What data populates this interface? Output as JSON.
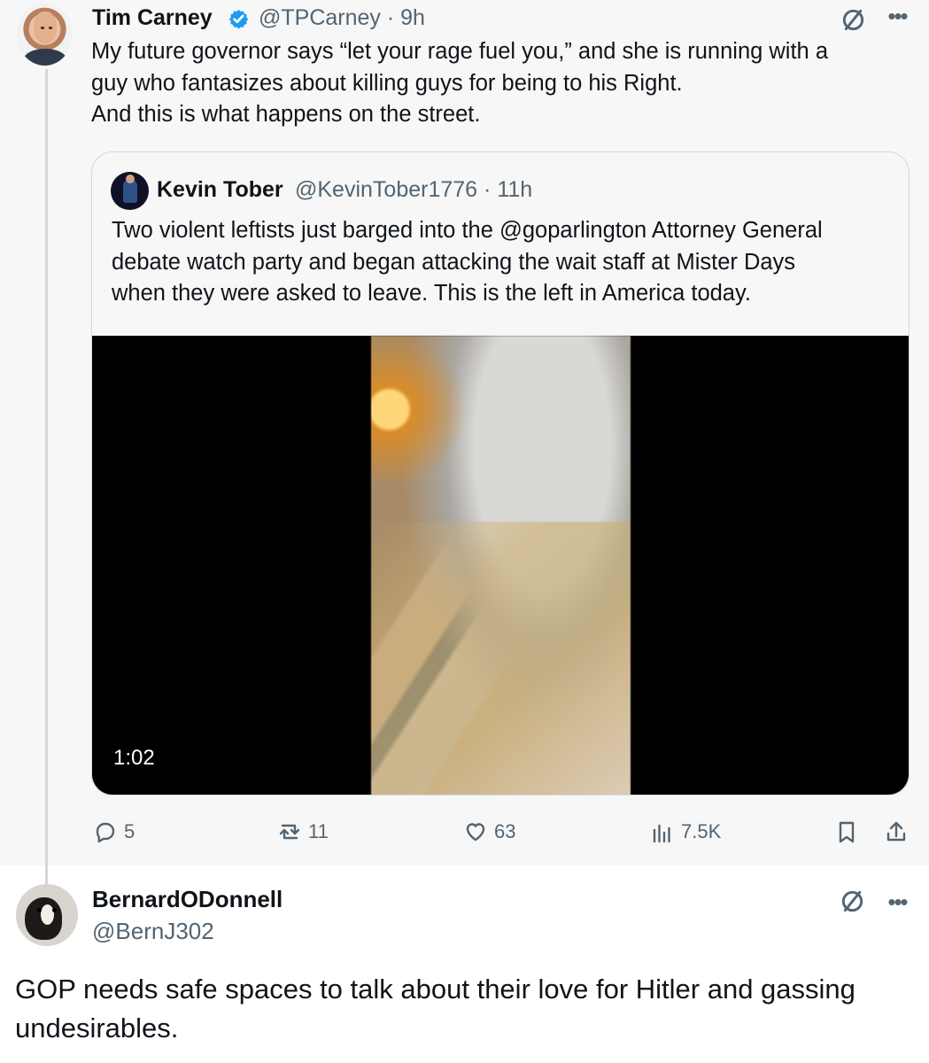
{
  "main_tweet": {
    "author": {
      "name": "Tim Carney",
      "handle": "@TPCarney",
      "separator": "·",
      "time": "9h",
      "verified": true,
      "avatar_icon": "user-avatar"
    },
    "lines": [
      "My future governor says “let your rage fuel you,” and she is running with a",
      "guy who fantasizes about killing guys for being to his Right.",
      "And this is what happens on the street."
    ],
    "quoted_tweet": {
      "name": "Kevin Tober",
      "handle": "@KevinTober1776",
      "separator": "·",
      "time": "11h",
      "lines": [
        "Two violent leftists just barged into the @goparlington Attorney General",
        "debate watch party and began attacking the wait staff at Mister Days",
        "when they were asked to leave. This is the left in America today."
      ],
      "video_duration": "1:02"
    },
    "actions": {
      "replies": "5",
      "reposts": "11",
      "likes": "63",
      "views": "7.5K"
    }
  },
  "reply": {
    "name": "BernardODonnell",
    "handle": "@BernJ302",
    "lines": [
      "GOP needs safe spaces to talk about their love for Hitler and gassing",
      "undesirables."
    ]
  },
  "colors": {
    "verified_blue": "#1d9bf0",
    "muted_gray": "#536471",
    "thread_line": "#cfd9de",
    "background_gray": "#f7f7f7"
  },
  "icons": {
    "menu": "no-entry-icon",
    "more": "more-horizontal-icon",
    "reply": "reply-icon",
    "repost": "repost-icon",
    "like": "heart-icon",
    "views": "views-icon",
    "bookmark": "bookmark-icon",
    "share": "share-icon"
  }
}
